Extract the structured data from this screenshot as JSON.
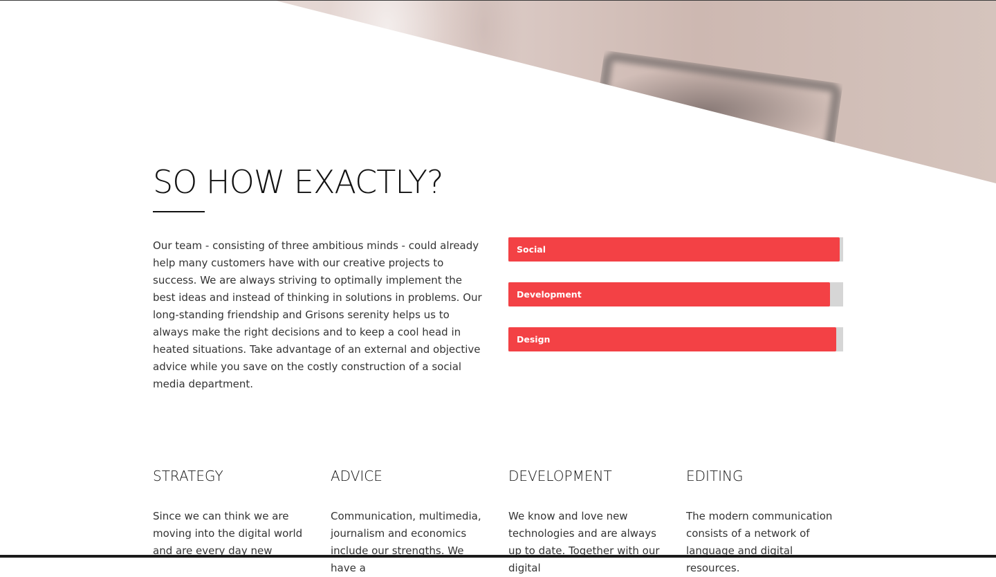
{
  "hero": {
    "image": "blurred-laptop-photo"
  },
  "section": {
    "title": "SO HOW EXACTLY?",
    "intro": "Our team - consisting of three ambitious minds - could already help many customers have with our creative projects to success. We are always striving to optimally implement the best ideas and instead of thinking in solutions in problems. Our long-standing friendship and Grisons serenity helps us to always make the right decisions and to keep a cool head in heated situations. Take advantage of an external and objective advice while you save on the costly construction of a social media department."
  },
  "skills": [
    {
      "label": "Social",
      "percent": 99
    },
    {
      "label": "Development",
      "percent": 96
    },
    {
      "label": "Design",
      "percent": 98
    }
  ],
  "services": [
    {
      "title": "STRATEGY",
      "text": "Since we can think we are moving into the digital world and are every day new"
    },
    {
      "title": "ADVICE",
      "text": "Communication, multimedia, journalism and economics include our strengths. We have a"
    },
    {
      "title": "DEVELOPMENT",
      "text": "We know and love new technologies and are always up to date. Together with our digital"
    },
    {
      "title": "EDITING",
      "text": "The modern communication consists of a network of language and digital resources."
    }
  ],
  "colors": {
    "accent": "#f34145",
    "track": "#d6d6d6",
    "heading": "#111111",
    "body_text": "#333333"
  }
}
